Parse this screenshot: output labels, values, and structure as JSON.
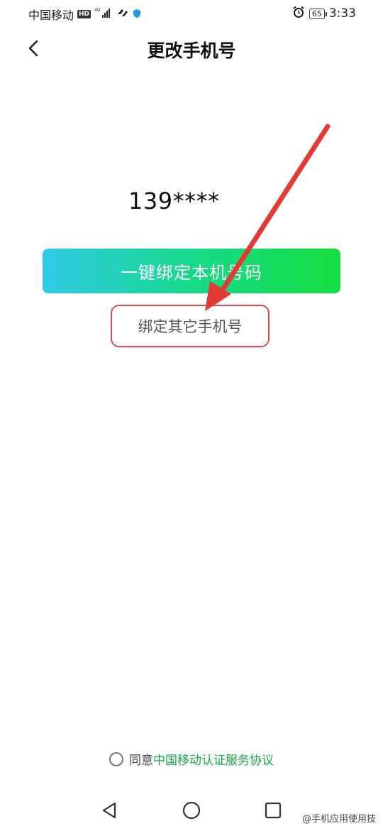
{
  "status_bar": {
    "carrier": "中国移动",
    "hd": "HD",
    "network": "4G",
    "battery": "65",
    "time": "3:33"
  },
  "header": {
    "title": "更改手机号",
    "back_icon": "chevron-left-icon"
  },
  "main": {
    "phone_number": "139****",
    "primary_button_label": "一键绑定本机号码",
    "secondary_button_label": "绑定其它手机号"
  },
  "agreement": {
    "prefix": "同意",
    "link_text": "中国移动认证服务协议",
    "link_color": "#1aa84a"
  },
  "nav_bar": {
    "back_icon": "triangle-back-icon",
    "home_icon": "circle-home-icon",
    "recent_icon": "square-recent-icon"
  },
  "watermark": "@手机应用使用技",
  "colors": {
    "primary_gradient_start": "#2fcbe6",
    "primary_gradient_end": "#15df3e",
    "annotation_red": "#e53935"
  }
}
